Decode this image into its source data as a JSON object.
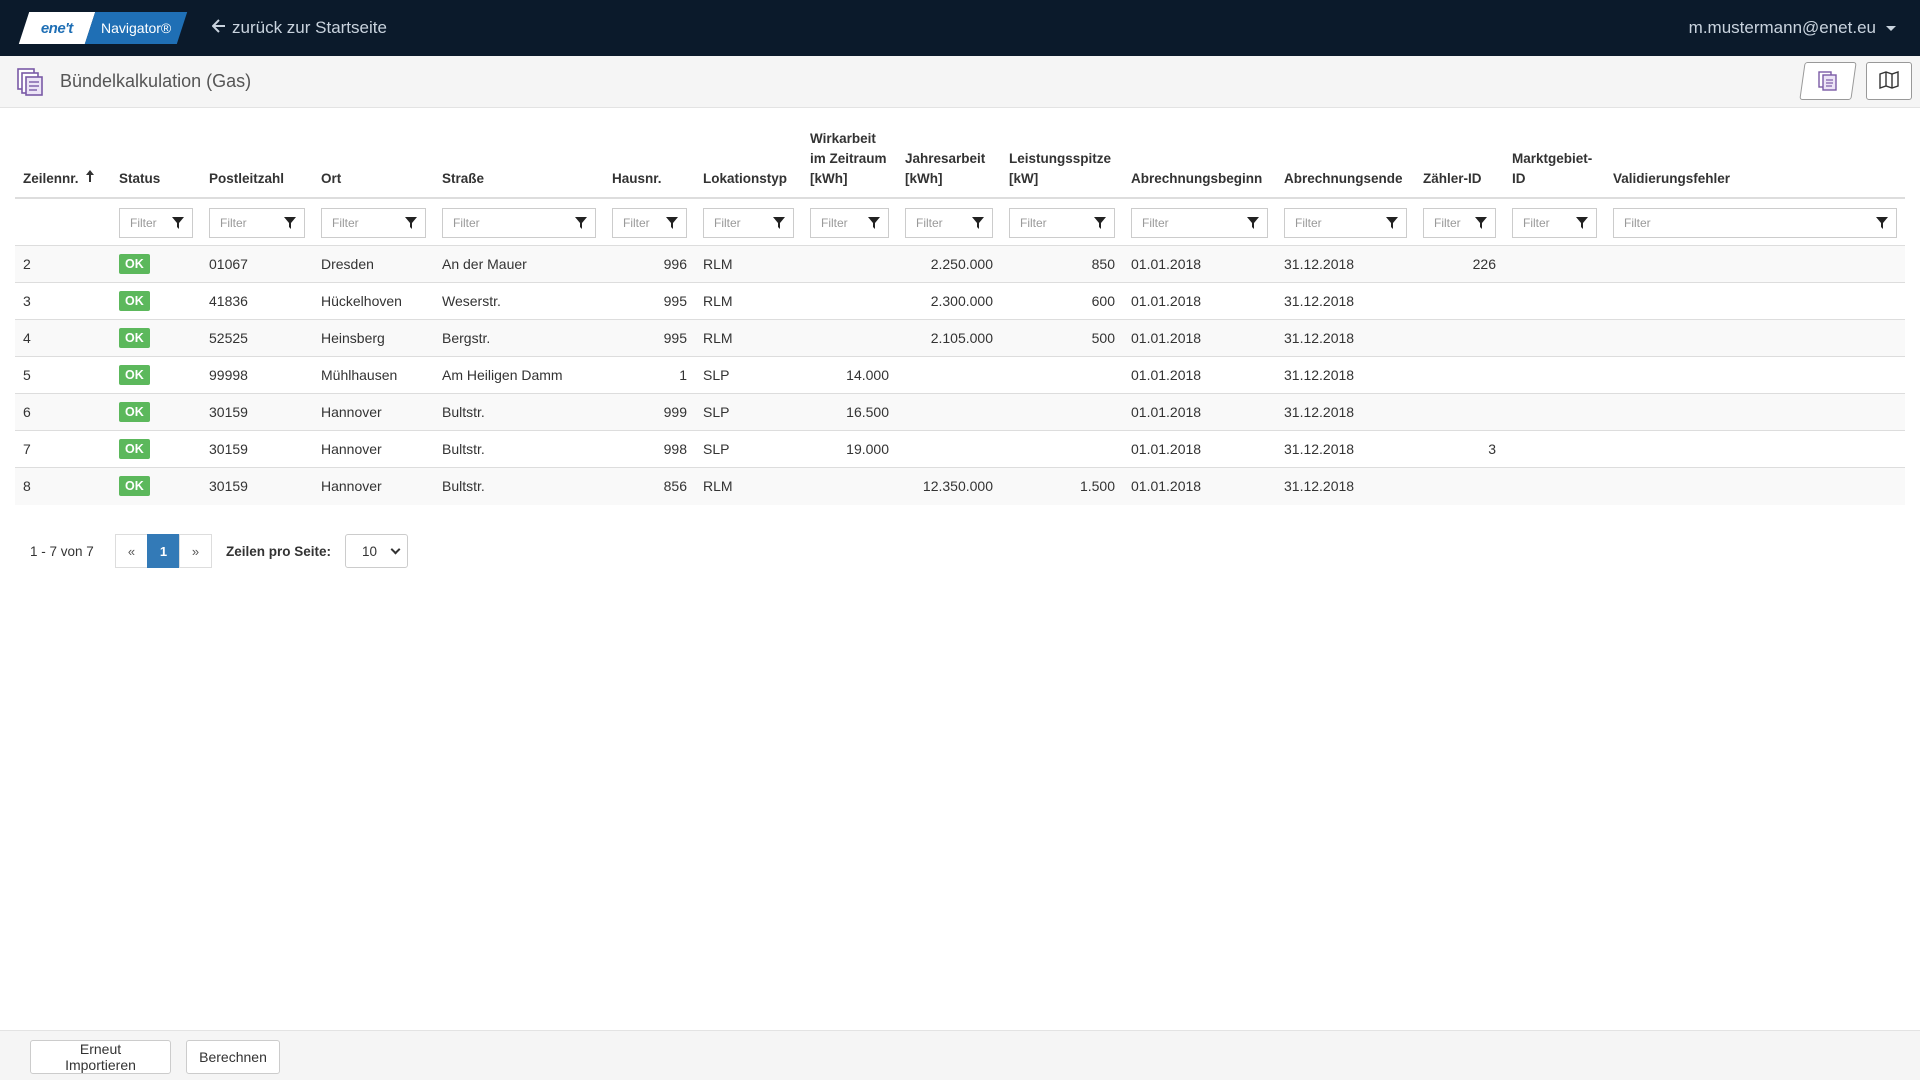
{
  "navbar": {
    "logo_text": "ene't",
    "brand_name": "Navigator®",
    "back_link": "zurück zur Startseite",
    "user": "m.mustermann@enet.eu"
  },
  "header": {
    "title": "Bündelkalkulation (Gas)"
  },
  "table": {
    "columns": [
      {
        "label": "Zeilennr.",
        "sorted": "asc"
      },
      {
        "label": "Status"
      },
      {
        "label": "Postleitzahl"
      },
      {
        "label": "Ort"
      },
      {
        "label": "Straße"
      },
      {
        "label": "Hausnr."
      },
      {
        "label": "Lokationstyp"
      },
      {
        "label": "Wirkarbeit im Zeitraum [kWh]"
      },
      {
        "label": "Jahresarbeit [kWh]"
      },
      {
        "label": "Leistungsspitze [kW]"
      },
      {
        "label": "Abrechnungsbeginn"
      },
      {
        "label": "Abrechnungsende"
      },
      {
        "label": "Zähler-ID"
      },
      {
        "label": "Marktgebiet-ID"
      },
      {
        "label": "Validierungsfehler"
      }
    ],
    "filter_placeholder": "Filter",
    "rows": [
      [
        "2",
        "OK",
        "01067",
        "Dresden",
        "An der Mauer",
        "996",
        "RLM",
        "",
        "2.250.000",
        "850",
        "01.01.2018",
        "31.12.2018",
        "226",
        "",
        ""
      ],
      [
        "3",
        "OK",
        "41836",
        "Hückelhoven",
        "Weserstr.",
        "995",
        "RLM",
        "",
        "2.300.000",
        "600",
        "01.01.2018",
        "31.12.2018",
        "",
        "",
        ""
      ],
      [
        "4",
        "OK",
        "52525",
        "Heinsberg",
        "Bergstr.",
        "995",
        "RLM",
        "",
        "2.105.000",
        "500",
        "01.01.2018",
        "31.12.2018",
        "",
        "",
        ""
      ],
      [
        "5",
        "OK",
        "99998",
        "Mühlhausen",
        "Am Heiligen Damm",
        "1",
        "SLP",
        "14.000",
        "",
        "",
        "01.01.2018",
        "31.12.2018",
        "",
        "",
        ""
      ],
      [
        "6",
        "OK",
        "30159",
        "Hannover",
        "Bultstr.",
        "999",
        "SLP",
        "16.500",
        "",
        "",
        "01.01.2018",
        "31.12.2018",
        "",
        "",
        ""
      ],
      [
        "7",
        "OK",
        "30159",
        "Hannover",
        "Bultstr.",
        "998",
        "SLP",
        "19.000",
        "",
        "",
        "01.01.2018",
        "31.12.2018",
        "3",
        "",
        ""
      ],
      [
        "8",
        "OK",
        "30159",
        "Hannover",
        "Bultstr.",
        "856",
        "RLM",
        "",
        "12.350.000",
        "1.500",
        "01.01.2018",
        "31.12.2018",
        "",
        "",
        ""
      ]
    ]
  },
  "pagination": {
    "info": "1 - 7 von 7",
    "prev": "«",
    "current_page": "1",
    "next": "»",
    "rows_per_page_label": "Zeilen pro Seite:",
    "rows_per_page_value": "10"
  },
  "footer": {
    "reimport_label": "Erneut Importieren",
    "calculate_label": "Berechnen"
  },
  "colors": {
    "navbar_bg": "#0b1a2b",
    "brand_blue": "#1f6fb5",
    "ok_badge": "#5cb85c",
    "page_active": "#337ab7"
  }
}
